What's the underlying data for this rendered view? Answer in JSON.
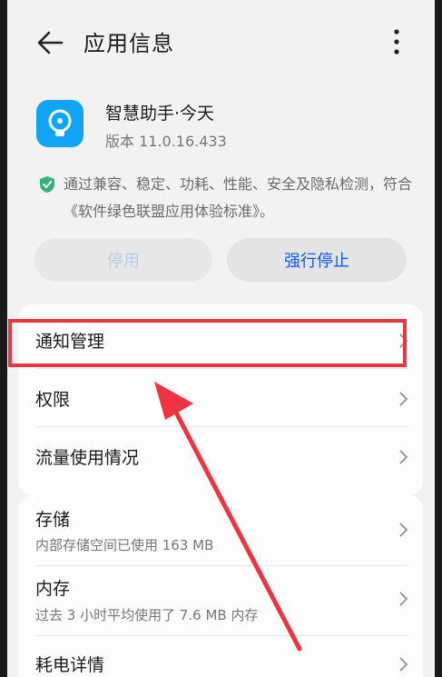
{
  "header": {
    "title": "应用信息"
  },
  "app": {
    "name": "智慧助手·今天",
    "version": "版本 11.0.16.433"
  },
  "notice": "通过兼容、稳定、功耗、性能、安全及隐私检测，符合《软件绿色联盟应用体验标准》。",
  "buttons": {
    "disable": "停用",
    "force_stop": "强行停止"
  },
  "settings": {
    "notification": "通知管理",
    "permissions": "权限",
    "data_usage": "流量使用情况",
    "storage": {
      "label": "存储",
      "detail": "内部存储空间已使用 163 MB"
    },
    "memory": {
      "label": "内存",
      "detail": "过去 3 小时平均使用了 7.6 MB 内存"
    },
    "battery": "耗电详情"
  },
  "colors": {
    "accent": "#0a59f7",
    "highlight": "#ef3340",
    "app_icon": "#12a5f6"
  }
}
